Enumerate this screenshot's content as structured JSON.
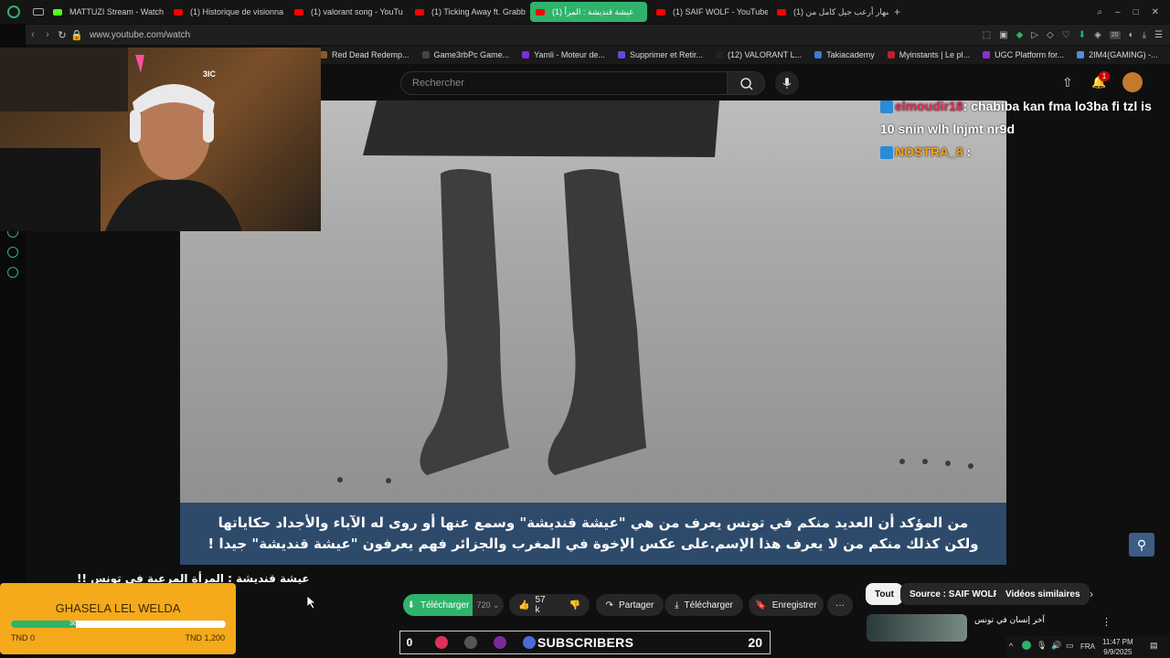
{
  "browser": {
    "tabs": [
      {
        "label": "MATTUZI Stream - Watch",
        "icon": "kick-icon",
        "color": "#53fc18"
      },
      {
        "label": "(1) Historique de visionna",
        "icon": "youtube-icon",
        "color": "#ff0000"
      },
      {
        "label": "(1) valorant song - YouTu",
        "icon": "youtube-icon",
        "color": "#ff0000"
      },
      {
        "label": "(1) Ticking Away ft. Grabb",
        "icon": "youtube-icon",
        "color": "#ff0000"
      },
      {
        "label": "(1) عيشة قنديشة : المرأ",
        "icon": "youtube-icon",
        "color": "#ff0000",
        "active": true
      },
      {
        "label": "(1) SAIF WOLF - YouTube",
        "icon": "youtube-icon",
        "color": "#ff0000"
      },
      {
        "label": "(1) إشهار أرعب جيل كامل من",
        "icon": "youtube-icon",
        "color": "#ff0000"
      }
    ],
    "url": "www.youtube.com/watch",
    "bookmarks": [
      {
        "label": "Red Dead Redemp..."
      },
      {
        "label": "Game3rbPc Game..."
      },
      {
        "label": "Yamli - Moteur de..."
      },
      {
        "label": "Supprimer et Retir..."
      },
      {
        "label": "(12) VALORANT L..."
      },
      {
        "label": "Takiacademy"
      },
      {
        "label": "Myinstants | Le pl..."
      },
      {
        "label": "UGC Platform for..."
      },
      {
        "label": "2IM4(GAMING) -..."
      }
    ],
    "extension_badge": "20"
  },
  "youtube": {
    "search": {
      "placeholder": "Rechercher"
    },
    "notification_count": "1",
    "video": {
      "subtitle_line1": "من المؤكد أن العديد منكم في تونس يعرف من هي \"عيشة قنديشة\" وسمع عنها أو روى له الآباء والأجداد حكاياتها",
      "subtitle_line2": "ولكن كذلك منكم من لا يعرف هذا الإسم.على عكس الإخوة في المغرب والجزائر فهم يعرفون \"عيشة قنديشة\" جيدا !"
    },
    "title": "عيشة قنديشة : المرأة المرعبة في تونس !!",
    "actions": {
      "download_green": "Télécharger",
      "quality": "720",
      "likes": "57 k",
      "share": "Partager",
      "download": "Télécharger",
      "save": "Enregistrer"
    },
    "chips": [
      "Tout",
      "Source : SAIF WOLF",
      "Vidéos similaires"
    ],
    "related_title": "آخر إنسان في تونس"
  },
  "overlay": {
    "cam_logo": "3IC",
    "chat": [
      {
        "user": "elmoudir18",
        "message": ": chabiba kan fma lo3ba fi tzl is"
      },
      {
        "user": "",
        "message": "10 snin wlh lnjmt nr9d"
      },
      {
        "user": "NOSTRA_8",
        "message": " :"
      }
    ],
    "goal": {
      "title": "GHASELA LEL WELDA",
      "current_label": "361",
      "progress_fraction": 0.3,
      "min_label": "TND 0",
      "max_label": "TND 1,200",
      "fill_color": "#2fb36a"
    },
    "subs": {
      "left_value": "0",
      "label": "SUBSCRIBERS",
      "count": "20"
    }
  },
  "tray": {
    "language": "FRA",
    "time": "11:47 PM",
    "date": "9/9/2025"
  }
}
